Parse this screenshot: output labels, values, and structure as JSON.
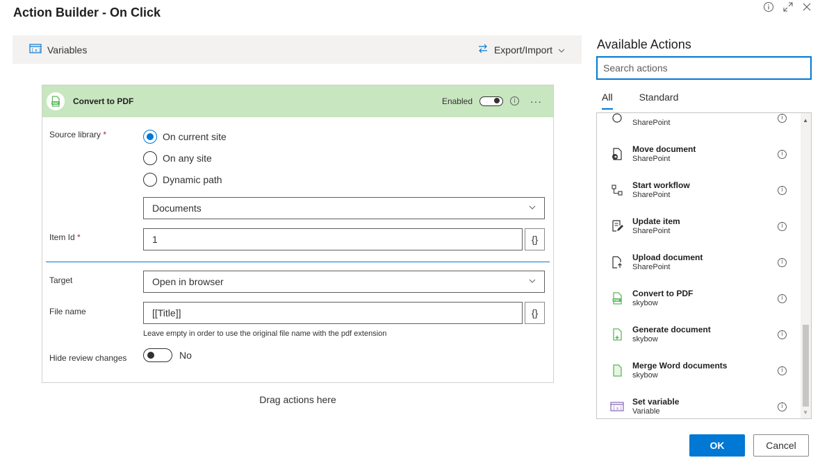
{
  "dialog": {
    "title": "Action Builder - On Click",
    "ok_label": "OK",
    "cancel_label": "Cancel"
  },
  "toolbar": {
    "variables_label": "Variables",
    "export_import_label": "Export/Import"
  },
  "card": {
    "title": "Convert to PDF",
    "enabled_label": "Enabled",
    "enabled": true,
    "more_label": "···",
    "source_library_label": "Source library",
    "required_mark": "*",
    "radio_options": [
      "On current site",
      "On any site",
      "Dynamic path"
    ],
    "selected_radio": "On current site",
    "library_value": "Documents",
    "item_id_label": "Item Id",
    "item_id_value": "1",
    "braces_label": "{}",
    "target_label": "Target",
    "target_value": "Open in browser",
    "file_name_label": "File name",
    "file_name_value": "[[Title]]",
    "file_name_hint": "Leave empty in order to use the original file name with the pdf extension",
    "hide_review_label": "Hide review changes",
    "hide_review_value": "No",
    "hide_review_on": false
  },
  "drag_hint": "Drag actions here",
  "actions_panel": {
    "title": "Available Actions",
    "search_placeholder": "Search actions",
    "tabs": [
      "All",
      "Standard"
    ],
    "active_tab": "All",
    "partial_item_sub": "SharePoint",
    "items": [
      {
        "name": "Move document",
        "source": "SharePoint",
        "icon": "move-document-icon"
      },
      {
        "name": "Start workflow",
        "source": "SharePoint",
        "icon": "workflow-icon"
      },
      {
        "name": "Update item",
        "source": "SharePoint",
        "icon": "edit-item-icon"
      },
      {
        "name": "Upload document",
        "source": "SharePoint",
        "icon": "upload-document-icon"
      },
      {
        "name": "Convert to PDF",
        "source": "skybow",
        "icon": "pdf-icon"
      },
      {
        "name": "Generate document",
        "source": "skybow",
        "icon": "generate-document-icon"
      },
      {
        "name": "Merge Word documents",
        "source": "skybow",
        "icon": "merge-documents-icon"
      },
      {
        "name": "Set variable",
        "source": "Variable",
        "icon": "variable-icon"
      }
    ]
  },
  "colors": {
    "accent": "#0078d4",
    "card_header": "#c8e6c0",
    "skybow_green": "#5cb85c",
    "variable_purple": "#8764b8"
  }
}
